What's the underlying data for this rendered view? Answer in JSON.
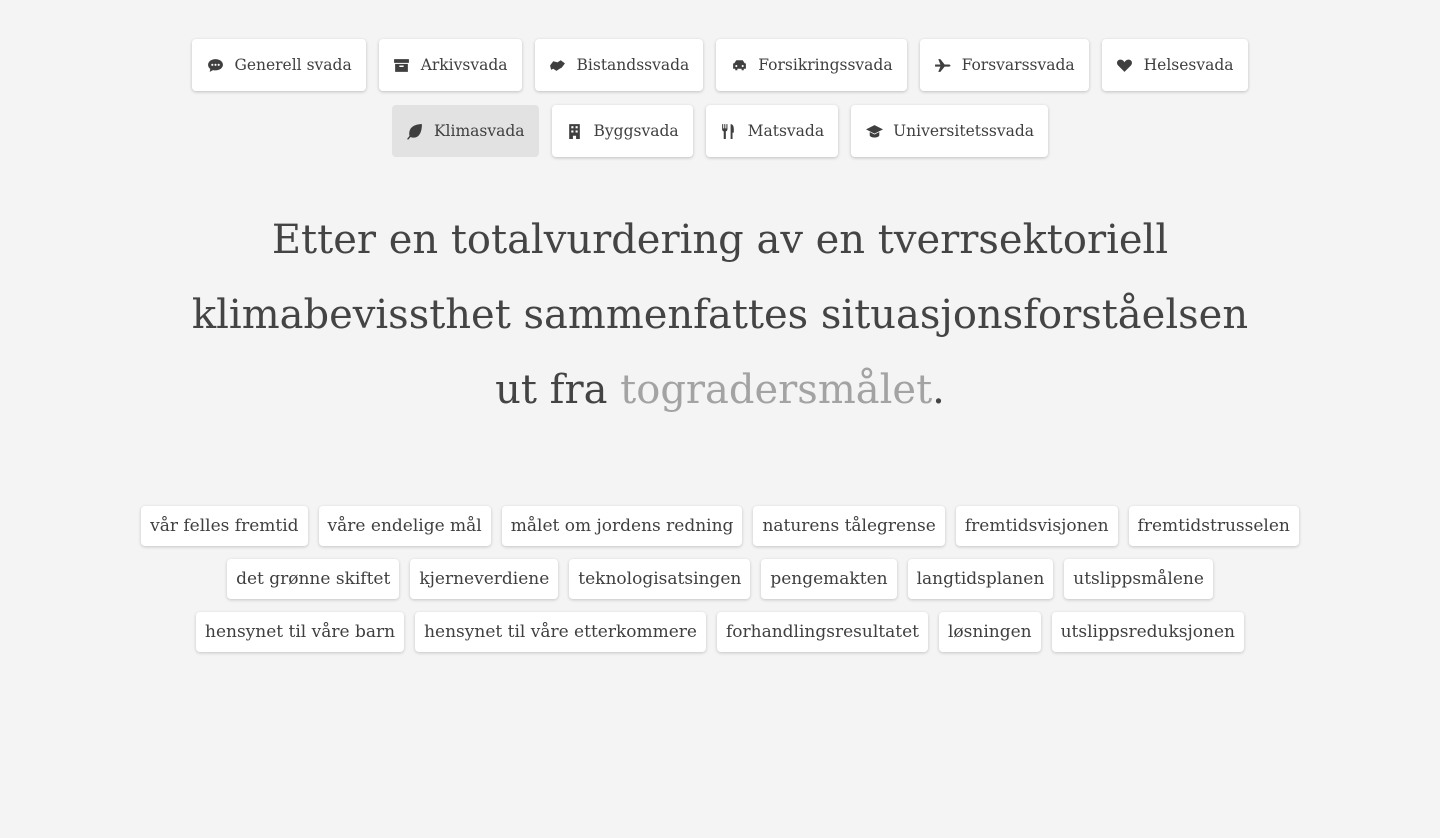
{
  "nav": {
    "row1": [
      {
        "label": "Generell svada",
        "icon": "speech-bubble-icon"
      },
      {
        "label": "Arkivsvada",
        "icon": "archive-box-icon"
      },
      {
        "label": "Bistandssvada",
        "icon": "handshake-icon"
      },
      {
        "label": "Forsikringssvada",
        "icon": "car-crash-icon"
      },
      {
        "label": "Forsvarssvada",
        "icon": "fighter-jet-icon"
      },
      {
        "label": "Helsesvada",
        "icon": "heart-icon"
      }
    ],
    "row2": [
      {
        "label": "Klimasvada",
        "icon": "leaf-icon",
        "active": true
      },
      {
        "label": "Byggsvada",
        "icon": "building-icon"
      },
      {
        "label": "Matsvada",
        "icon": "cutlery-icon"
      },
      {
        "label": "Universitetssvada",
        "icon": "graduation-cap-icon"
      }
    ]
  },
  "sentence": {
    "line1": "Etter en totalvurdering av en tverrsektoriell",
    "line2": "klimabevissthet sammenfattes situasjonsforståelsen",
    "line3_prefix": "ut fra ",
    "highlight": "togradersmålet",
    "suffix": "."
  },
  "tags": {
    "row1": [
      "vår felles fremtid",
      "våre endelige mål",
      "målet om jordens redning",
      "naturens tålegrense",
      "fremtidsvisjonen",
      "fremtidstrusselen"
    ],
    "row2": [
      "det grønne skiftet",
      "kjerneverdiene",
      "teknologisatsingen",
      "pengemakten",
      "langtidsplanen",
      "utslippsmålene"
    ],
    "row3": [
      "hensynet til våre barn",
      "hensynet til våre etterkommere",
      "forhandlingsresultatet",
      "løsningen",
      "utslippsreduksjonen"
    ]
  },
  "colors": {
    "background": "#f4f4f4",
    "text": "#444444",
    "highlight": "#a3a3a3",
    "active_button": "#e2e2e2"
  }
}
